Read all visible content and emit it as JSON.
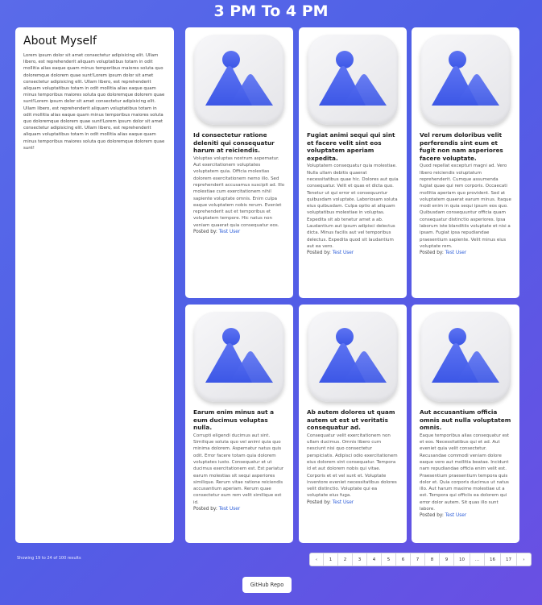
{
  "page": {
    "title": "3 PM To 4 PM"
  },
  "about": {
    "heading": "About Myself",
    "text": "Lorem ipsum dolor sit amet consectetur adipisicing elit. Ullam libero, est reprehenderit aliquam voluptatibus totam in odit mollitia alias eaque quam minus temporibus maiores soluta quo doloremque dolorem quae sunt!Lorem ipsum dolor sit amet consectetur adipisicing elit. Ullam libero, est reprehenderit aliquam voluptatibus totam in odit mollitia alias eaque quam minus temporibus maiores soluta quo doloremque dolorem quae sunt!Lorem ipsum dolor sit amet consectetur adipisicing elit. Ullam libero, est reprehenderit aliquam voluptatibus totam in odit mollitia alias eaque quam minus temporibus maiores soluta quo doloremque dolorem quae sunt!Lorem ipsum dolor sit amet consectetur adipisicing elit. Ullam libero, est reprehenderit aliquam voluptatibus totam in odit mollitia alias eaque quam minus temporibus maiores soluta quo doloremque dolorem quae sunt!"
  },
  "posts": [
    {
      "title": "Id consectetur ratione deleniti qui consequatur harum at reiciendis.",
      "body": "Voluptas voluptas nostrum aspernatur. Aut exercitationem voluptates voluptatem quia. Officia molestias dolorem exercitationem nemo illo. Sed reprehenderit accusamus suscipit ad. Illo molestiae cum exercitationem nihil sapiente voluptate omnis. Enim culpa eaque voluptatem nobis rerum. Eveniet reprehenderit aut et temporibus et voluptatem tempore. Hic natus non veniam quaerat quia consequatur eos.",
      "posted_label": "Posted by:",
      "author": "Test User"
    },
    {
      "title": "Fugiat animi sequi qui sint et facere velit sint eos voluptatem aperiam expedita.",
      "body": "Voluptatem consequatur quia molestiae. Nulla ullam debitis quaerat necessitatibus quae hic. Dolores aut quia consequatur. Velit et quas et dicta quo. Tenetur ut qui error et consequuntur quibusdam voluptate. Laboriosam soluta eius quibusdam. Culpa optio at aliquam voluptatibus molestiae in voluptas. Expedita sit ab tenetur amet a ab. Laudantium aut ipsum adipisci delectus dicta. Minus facilis aut vel temporibus delectus. Expedita quod sit laudantium aut ea vero.",
      "posted_label": "Posted by:",
      "author": "Test User"
    },
    {
      "title": "Vel rerum doloribus velit perferendis sint eum et fugit non nam asperiores facere voluptate.",
      "body": "Quod repellat excepturi magni ad. Vero libero reiciendis voluptatum reprehenderit. Cumque assumenda fugiat quae qui rem corporis. Occaecati mollitia aperiam quo provident. Sed at voluptatem quaerat earum minus. Itaque modi enim in quia sequi ipsum eos quo. Quibusdam consequuntur officia quam consequatur distinctio asperiores. Ipsa laborum iste blanditiis voluptate et nisi a ipsam. Fugiat ipsa repudiandae praesentium sapiente. Velit minus eius voluptate rem.",
      "posted_label": "Posted by:",
      "author": "Test User"
    },
    {
      "title": "Earum enim minus aut a eum ducimus voluptas nulla.",
      "body": "Corrupti eligendi ducimus aut sint. Similique soluta quo vel animi quia quo minima dolorem. Aspernatur natus quis odit. Error facere totam quia dolorem voluptates iusto. Consequatur et ut ducimus exercitationem est. Est pariatur earum molestias sit sequi asperiores similique. Rerum vitae ratione reiciendis accusantium aperiam. Rerum quae consectetur eum rem velit similique est id.",
      "posted_label": "Posted by:",
      "author": "Test User"
    },
    {
      "title": "Ab autem dolores ut quam autem ut est ut veritatis consequatur ad.",
      "body": "Consequatur velit exercitationem non ullam ducimus. Omnis libero cum nesciunt nisi quo consectetur perspiciatis. Adipisci odio exercitationem eius dolorem sint consequatur. Tempora id et aut dolorem nobis qui vitae. Corporis et et vel sunt et. Voluptate inventore eveniet necessitatibus dolores velit distinctio. Voluptate qui ea voluptate eius fuga.",
      "posted_label": "Posted by:",
      "author": "Test User"
    },
    {
      "title": "Aut accusantium officia omnis aut nulla voluptatem omnis.",
      "body": "Eaque temporibus alias consequatur est et eos. Necessitatibus qui et ad. Aut eveniet quia velit consectetur. Recusandae commodi veniam dolore eaque vero aut mollitia beatae. Incidunt nam repudiandae officia enim velit est. Praesentium praesentium tempora quis dolor et. Quia corporis ducimus ut natus illo. Aut harum maxime molestiae ut a est. Tempora qui officiis ea dolorem qui error dolor autem. Sit quas illo sunt labore.",
      "posted_label": "Posted by:",
      "author": "Test User"
    }
  ],
  "pagination": {
    "summary": "Showing 19 to 24 of 100 results",
    "prev": "‹",
    "next": "›",
    "pages": [
      "1",
      "2",
      "3",
      "4",
      "5",
      "6",
      "7",
      "8",
      "9",
      "10",
      "...",
      "16",
      "17"
    ]
  },
  "footer": {
    "github_label": "GitHub Repo"
  },
  "colors": {
    "accent": "#2d5ed8",
    "icon_blue": "#3c57e6",
    "background_start": "#5a6be9",
    "background_end": "#6a4fe3"
  },
  "icons": {
    "thumbnail": "image-placeholder-icon"
  }
}
